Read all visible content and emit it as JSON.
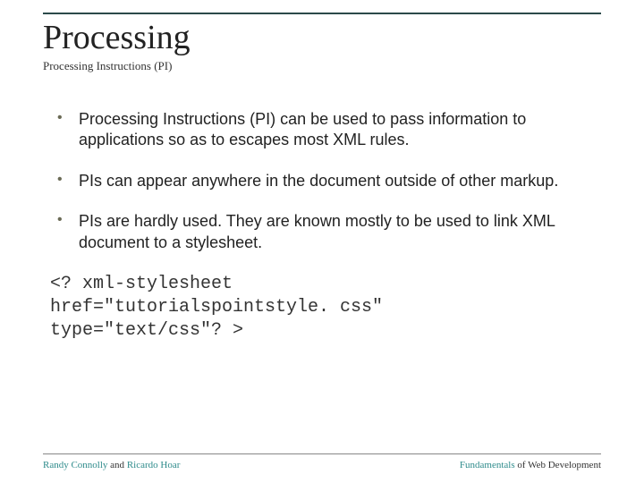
{
  "title": "Processing",
  "subtitle": "Processing Instructions (PI)",
  "bullets": [
    "Processing Instructions (PI) can be used to pass information to applications so as to escapes most XML rules.",
    "PIs can appear anywhere in the document outside of other markup.",
    "PIs are hardly used. They are known mostly to be used to link XML document to a stylesheet."
  ],
  "code": "<? xml-stylesheet\nhref=\"tutorialspointstyle. css\"\ntype=\"text/css\"? >",
  "footer": {
    "author1": "Randy Connolly",
    "conj": " and ",
    "author2": "Ricardo Hoar",
    "right_pre": "Fundamentals ",
    "right_post": "of Web Development"
  }
}
